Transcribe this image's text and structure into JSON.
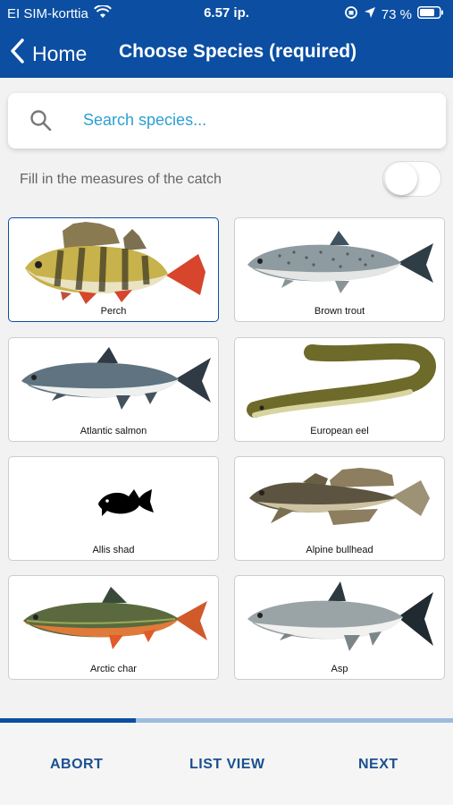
{
  "status_bar": {
    "carrier": "EI SIM-korttia",
    "time": "6.57 ip.",
    "battery": "73 %",
    "icons": [
      "wifi-icon",
      "lock-rotation-icon",
      "location-arrow-icon",
      "battery-icon"
    ]
  },
  "nav": {
    "back_label": "Home",
    "title": "Choose Species (required)"
  },
  "search": {
    "placeholder": "Search species..."
  },
  "measures": {
    "label": "Fill in the measures of the catch",
    "enabled": false
  },
  "species": [
    {
      "name": "Perch",
      "selected": true
    },
    {
      "name": "Brown trout",
      "selected": false
    },
    {
      "name": "Atlantic salmon",
      "selected": false
    },
    {
      "name": "European eel",
      "selected": false
    },
    {
      "name": "Allis shad",
      "selected": false
    },
    {
      "name": "Alpine bullhead",
      "selected": false
    },
    {
      "name": "Arctic char",
      "selected": false
    },
    {
      "name": "Asp",
      "selected": false
    }
  ],
  "progress": {
    "fraction": 0.3
  },
  "footer": {
    "abort": "ABORT",
    "list_view": "LIST VIEW",
    "next": "NEXT"
  },
  "colors": {
    "brand": "#0b4ea2",
    "link": "#2b9fd3",
    "footer_text": "#1b4f8f"
  }
}
